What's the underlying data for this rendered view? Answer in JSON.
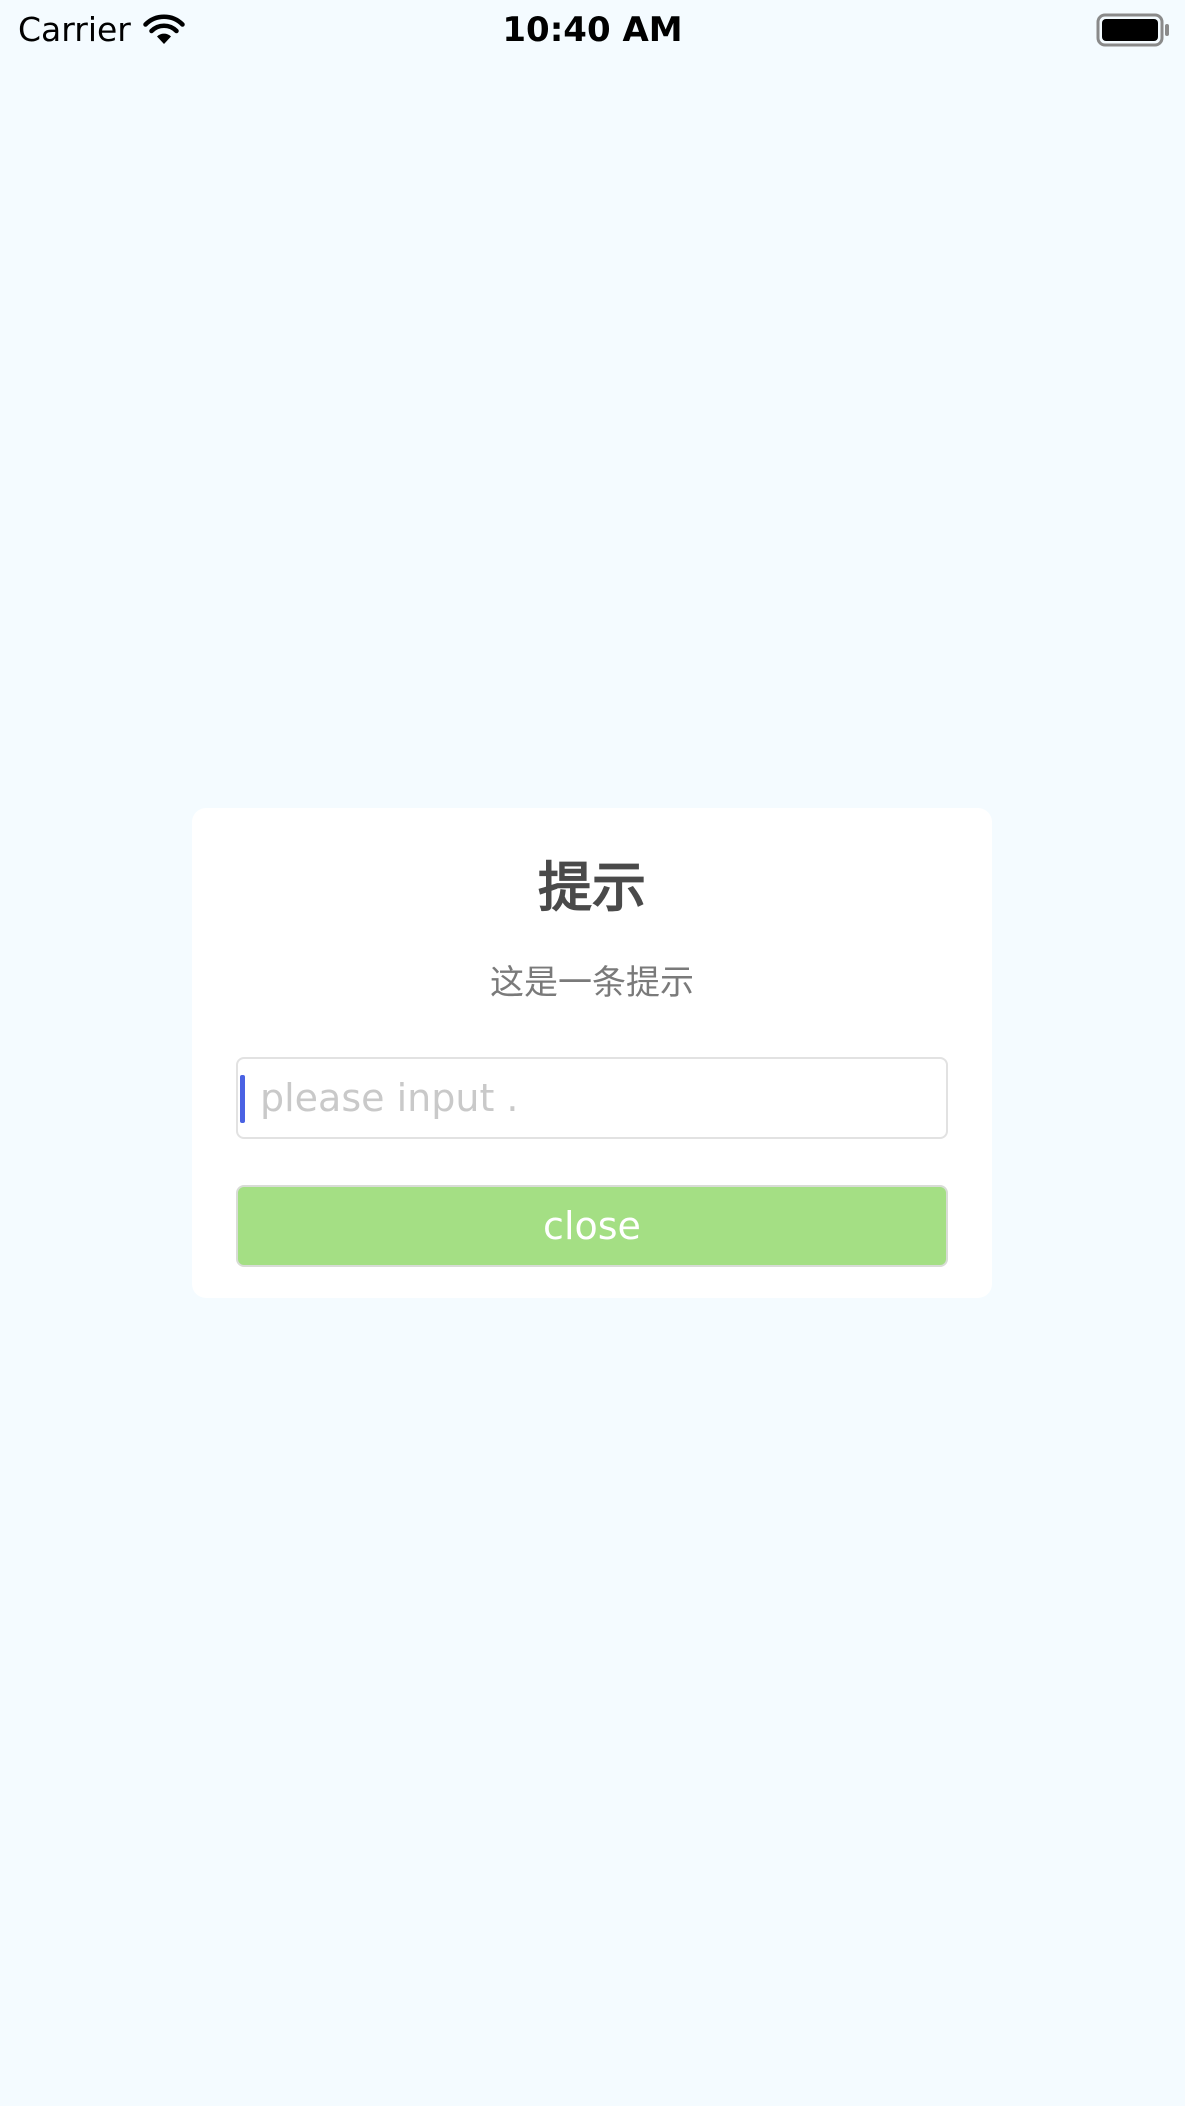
{
  "status_bar": {
    "carrier": "Carrier",
    "time": "10:40 AM",
    "icons": [
      "wifi-icon",
      "battery-icon"
    ]
  },
  "dialog": {
    "title": "提示",
    "message": "这是一条提示",
    "input": {
      "value": "",
      "placeholder": "please input ."
    },
    "close_label": "close"
  },
  "colors": {
    "background": "#f4fbff",
    "dialog": "#ffffff",
    "button": "#a4df84",
    "caret": "#4a62e3",
    "title_text": "#4a4a4a",
    "message_text": "#7a7a7a",
    "placeholder_text": "#c9c9c9"
  }
}
